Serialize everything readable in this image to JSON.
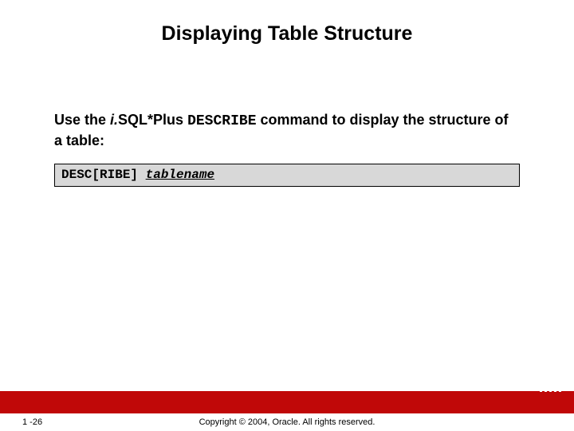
{
  "title": "Displaying Table Structure",
  "para": {
    "pre": "Use the ",
    "i_prefix": "i.",
    "product": "SQL*Plus ",
    "command": "DESCRIBE",
    "post": " command to display the structure of a table:"
  },
  "code": {
    "cmd": "DESC[RIBE] ",
    "arg": "tablename"
  },
  "footer": {
    "page": "1 -26",
    "copyright": "Copyright © 2004, Oracle.  All rights reserved."
  },
  "logo": {
    "text": "ORACLE"
  }
}
